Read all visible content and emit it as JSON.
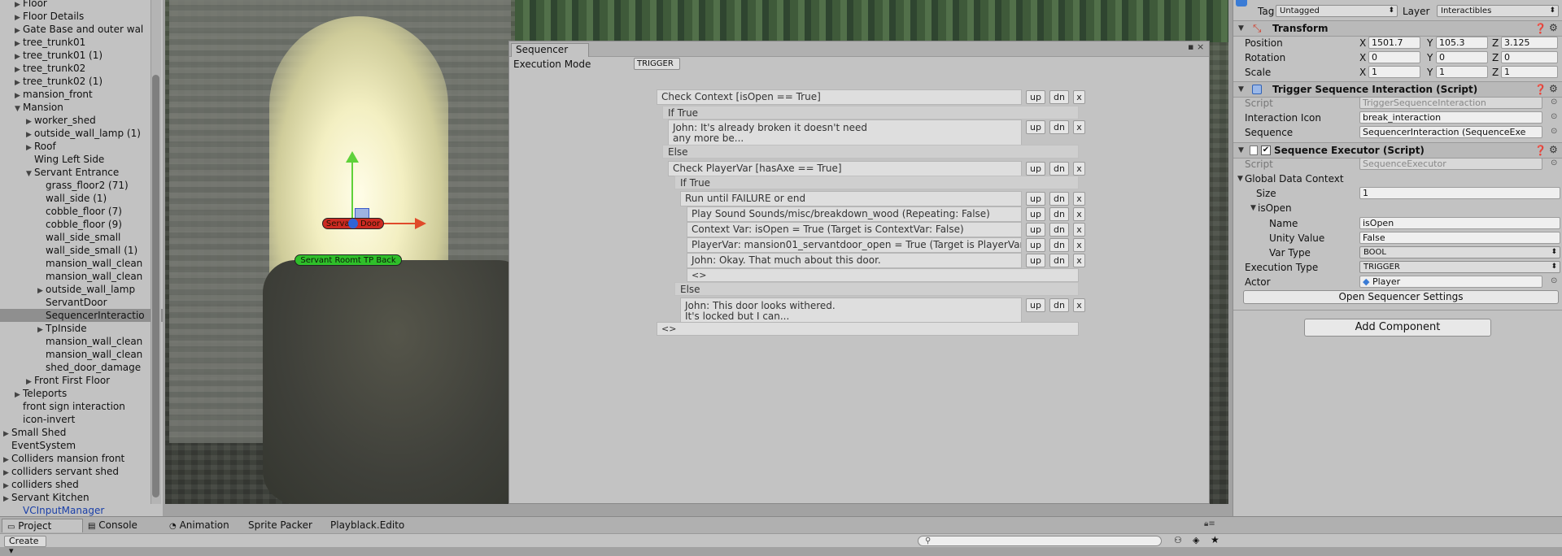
{
  "hierarchy": {
    "items": [
      {
        "label": "Floor",
        "indent": 2,
        "arrow": "▶"
      },
      {
        "label": "Floor Details",
        "indent": 2,
        "arrow": "▶"
      },
      {
        "label": "Gate Base and outer wal",
        "indent": 2,
        "arrow": "▶"
      },
      {
        "label": "tree_trunk01",
        "indent": 2,
        "arrow": "▶"
      },
      {
        "label": "tree_trunk01 (1)",
        "indent": 2,
        "arrow": "▶"
      },
      {
        "label": "tree_trunk02",
        "indent": 2,
        "arrow": "▶"
      },
      {
        "label": "tree_trunk02 (1)",
        "indent": 2,
        "arrow": "▶"
      },
      {
        "label": "mansion_front",
        "indent": 2,
        "arrow": "▶"
      },
      {
        "label": "Mansion",
        "indent": 2,
        "arrow": "▼"
      },
      {
        "label": "worker_shed",
        "indent": 3,
        "arrow": "▶"
      },
      {
        "label": "outside_wall_lamp (1)",
        "indent": 3,
        "arrow": "▶"
      },
      {
        "label": "Roof",
        "indent": 3,
        "arrow": "▶"
      },
      {
        "label": "Wing Left Side",
        "indent": 3,
        "arrow": ""
      },
      {
        "label": "Servant Entrance",
        "indent": 3,
        "arrow": "▼"
      },
      {
        "label": "grass_floor2 (71)",
        "indent": 4,
        "arrow": ""
      },
      {
        "label": "wall_side (1)",
        "indent": 4,
        "arrow": ""
      },
      {
        "label": "cobble_floor (7)",
        "indent": 4,
        "arrow": ""
      },
      {
        "label": "cobble_floor (9)",
        "indent": 4,
        "arrow": ""
      },
      {
        "label": "wall_side_small",
        "indent": 4,
        "arrow": ""
      },
      {
        "label": "wall_side_small (1)",
        "indent": 4,
        "arrow": ""
      },
      {
        "label": "mansion_wall_clean",
        "indent": 4,
        "arrow": ""
      },
      {
        "label": "mansion_wall_clean",
        "indent": 4,
        "arrow": ""
      },
      {
        "label": "outside_wall_lamp",
        "indent": 4,
        "arrow": "▶"
      },
      {
        "label": "ServantDoor",
        "indent": 4,
        "arrow": ""
      },
      {
        "label": "SequencerInteractio",
        "indent": 4,
        "arrow": "",
        "selected": true
      },
      {
        "label": "TpInside",
        "indent": 4,
        "arrow": "▶"
      },
      {
        "label": "mansion_wall_clean",
        "indent": 4,
        "arrow": ""
      },
      {
        "label": "mansion_wall_clean",
        "indent": 4,
        "arrow": ""
      },
      {
        "label": "shed_door_damage",
        "indent": 4,
        "arrow": ""
      },
      {
        "label": "Front First Floor",
        "indent": 3,
        "arrow": "▶"
      },
      {
        "label": "Teleports",
        "indent": 2,
        "arrow": "▶"
      },
      {
        "label": "front sign interaction",
        "indent": 2,
        "arrow": ""
      },
      {
        "label": "icon-invert",
        "indent": 2,
        "arrow": ""
      },
      {
        "label": "Small Shed",
        "indent": 1,
        "arrow": "▶"
      },
      {
        "label": "EventSystem",
        "indent": 1,
        "arrow": ""
      },
      {
        "label": "Colliders mansion front",
        "indent": 1,
        "arrow": "▶"
      },
      {
        "label": "colliders servant shed",
        "indent": 1,
        "arrow": "▶"
      },
      {
        "label": "colliders shed",
        "indent": 1,
        "arrow": "▶"
      },
      {
        "label": "Servant Kitchen",
        "indent": 1,
        "arrow": "▶"
      },
      {
        "label": "VCInputManager",
        "indent": 2,
        "arrow": "",
        "blue": true
      }
    ]
  },
  "scene": {
    "door_label": "Servant Door",
    "tp_label": "Servant Roomt TP Back"
  },
  "sequencer": {
    "tab": "Sequencer",
    "window_controls": "▪ ×",
    "exec_label": "Execution Mode",
    "exec_value": "TRIGGER",
    "btn_up": "up",
    "btn_dn": "dn",
    "btn_x": "x",
    "check_context": "Check Context [isOpen == True]",
    "if_true": "If True",
    "john_broken": "John: It's already broken it doesn't need\nany more be...",
    "else": "Else",
    "check_playervar": "Check PlayerVar [hasAxe == True]",
    "if_true2": "If True",
    "run_until": "Run until FAILURE or end",
    "play_sound": "Play Sound Sounds/misc/breakdown_wood (Repeating: False)",
    "context_var": "Context Var: isOpen = True (Target is ContextVar: False)",
    "player_var": "PlayerVar: mansion01_servantdoor_open = True (Target is PlayerVar: False)",
    "john_okay": "John: Okay. That much about this door.",
    "empty1": "<>",
    "else2": "Else",
    "john_withered": "John: This door looks withered.\nIt's locked but I can...",
    "empty2": "<>"
  },
  "inspector": {
    "tag_label": "Tag",
    "tag_value": "Untagged",
    "layer_label": "Layer",
    "layer_value": "Interactibles",
    "transform_title": "Transform",
    "position_label": "Position",
    "rotation_label": "Rotation",
    "scale_label": "Scale",
    "position": {
      "x": "1501.7",
      "y": "105.3",
      "z": "3.125"
    },
    "rotation": {
      "x": "0",
      "y": "0",
      "z": "0"
    },
    "scale": {
      "x": "1",
      "y": "1",
      "z": "1"
    },
    "axis_x": "X",
    "axis_y": "Y",
    "axis_z": "Z",
    "trigger_title": "Trigger Sequence Interaction (Script)",
    "script_label": "Script",
    "trigger_script": "TriggerSequenceInteraction",
    "icon_label": "Interaction Icon",
    "icon_value": "break_interaction",
    "sequence_label": "Sequence",
    "sequence_value": "SequencerInteraction (SequenceExe",
    "executor_title": "Sequence Executor (Script)",
    "executor_script": "SequenceExecutor",
    "global_label": "Global Data Context",
    "size_label": "Size",
    "size_value": "1",
    "isopen_label": "isOpen",
    "name_label": "Name",
    "name_value": "isOpen",
    "unity_label": "Unity Value",
    "unity_value": "False",
    "vartype_label": "Var Type",
    "vartype_value": "BOOL",
    "exectype_label": "Execution Type",
    "exectype_value": "TRIGGER",
    "actor_label": "Actor",
    "actor_value": "Player",
    "open_settings": "Open Sequencer Settings",
    "add_component": "Add Component"
  },
  "bottom": {
    "tabs": [
      "Project",
      "Console",
      "Animation",
      "Sprite Packer",
      "Playblack.Edito"
    ],
    "create": "Create"
  }
}
